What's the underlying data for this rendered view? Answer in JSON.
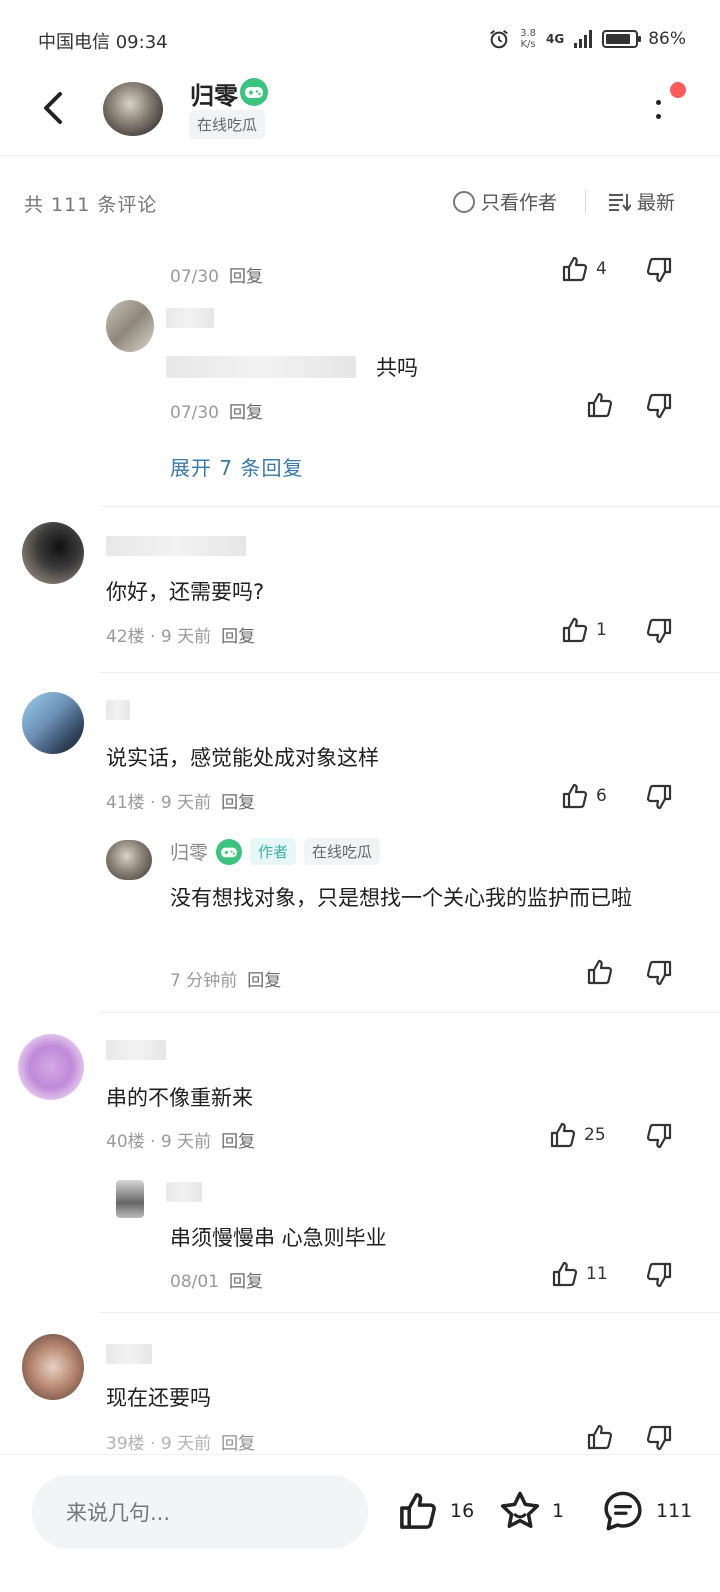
{
  "status_bar": {
    "carrier_time": "中国电信 09:34",
    "speed_value": "3.8",
    "speed_unit": "K/s",
    "network": "4G",
    "battery": "86%",
    "battery_level": 0.86
  },
  "header": {
    "username": "归零",
    "status_tag": "在线吃瓜"
  },
  "toolbar": {
    "count": "共 111 条评论",
    "only_author": "只看作者",
    "sort": "最新"
  },
  "comments": {
    "top_reply": {
      "time": "07/30",
      "reply": "回复",
      "likes": "4"
    },
    "sub_reply": {
      "text_suffix": "共吗",
      "time": "07/30",
      "reply": "回复"
    },
    "expand": "展开 7 条回复",
    "c1": {
      "text": "你好，还需要吗?",
      "meta": "42楼 · 9 天前",
      "reply": "回复",
      "likes": "1"
    },
    "c2": {
      "text": "说实话，感觉能处成对象这样",
      "meta": "41楼 · 9 天前",
      "reply": "回复",
      "likes": "6"
    },
    "c2_reply": {
      "name": "归零",
      "author_tag": "作者",
      "status_tag": "在线吃瓜",
      "text": "没有想找对象，只是想找一个关心我的监护而已啦",
      "time": "7 分钟前",
      "reply": "回复"
    },
    "c3": {
      "text": "串的不像重新来",
      "meta": "40楼 · 9 天前",
      "reply": "回复",
      "likes": "25"
    },
    "c3_reply": {
      "text": "串须慢慢串 心急则毕业",
      "time": "08/01",
      "reply": "回复",
      "likes": "11"
    },
    "c4": {
      "text": "现在还要吗",
      "meta": "39楼 · 9 天前",
      "reply": "回复"
    }
  },
  "bottom_bar": {
    "placeholder": "来说几句...",
    "likes": "16",
    "stars": "1",
    "comments": "111"
  },
  "colors": {
    "accent_green": "#3ac47d",
    "link_blue": "#3a79a8",
    "red_dot": "#ff5b5b",
    "author_teal": "#3bb3a6"
  }
}
